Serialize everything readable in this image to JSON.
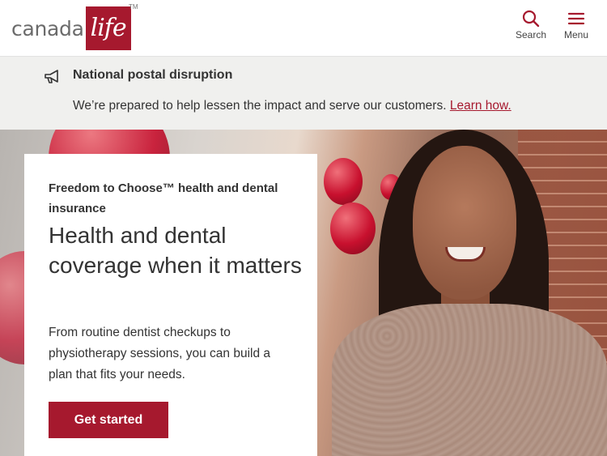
{
  "brand": {
    "word": "canada",
    "box_word": "life",
    "trademark": "TM",
    "color": "#a6192e"
  },
  "header": {
    "search_label": "Search",
    "menu_label": "Menu",
    "search_icon": "search-icon",
    "menu_icon": "hamburger-menu-icon"
  },
  "alert": {
    "icon": "megaphone-icon",
    "title": "National postal disruption",
    "text": "We’re prepared to help lessen the impact and serve our customers.",
    "link_text": "Learn how."
  },
  "hero": {
    "eyebrow": "Freedom to Choose™ health and dental insurance",
    "headline": "Health and dental coverage when it matters",
    "body": "From routine dentist checkups to physiotherapy sessions, you can build a plan that fits your needs.",
    "cta_label": "Get started"
  }
}
